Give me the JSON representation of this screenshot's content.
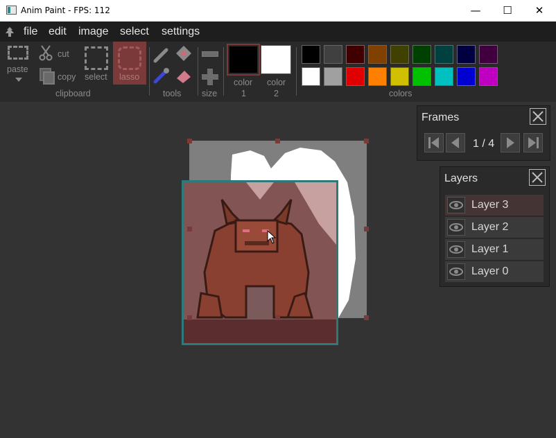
{
  "window": {
    "title": "Anim Paint - FPS: 112",
    "minimize": "—",
    "maximize": "☐",
    "close": "✕"
  },
  "menu": {
    "items": [
      "file",
      "edit",
      "image",
      "select",
      "settings"
    ]
  },
  "toolbar": {
    "paste_label": "paste",
    "cut_label": "cut",
    "copy_label": "copy",
    "select_label": "select",
    "lasso_label": "lasso",
    "clipboard_group": "clipboard",
    "tools_group": "tools",
    "size_group": "size",
    "color1_label_a": "color",
    "color1_label_b": "1",
    "color2_label_a": "color",
    "color2_label_b": "2",
    "colors_group": "colors",
    "color1": "#000000",
    "color2": "#ffffff",
    "palette_row1": [
      "#000000",
      "#404040",
      "#400000",
      "#804000",
      "#404000",
      "#004000",
      "#004040",
      "#000040",
      "#400040"
    ],
    "palette_row2": [
      "#ffffff",
      "#a0a0a0",
      "#e00000",
      "#ff8000",
      "#d0c000",
      "#00c000",
      "#00c0c0",
      "#0000d0",
      "#c000c0"
    ]
  },
  "frames": {
    "title": "Frames",
    "counter": "1 / 4"
  },
  "layers": {
    "title": "Layers",
    "items": [
      "Layer 3",
      "Layer 2",
      "Layer 1",
      "Layer 0"
    ],
    "selected_index": 0
  },
  "colors": {
    "accent_lasso": "#7a3a3a",
    "selection_frame": "#2e7a7a",
    "background": "#333333"
  }
}
